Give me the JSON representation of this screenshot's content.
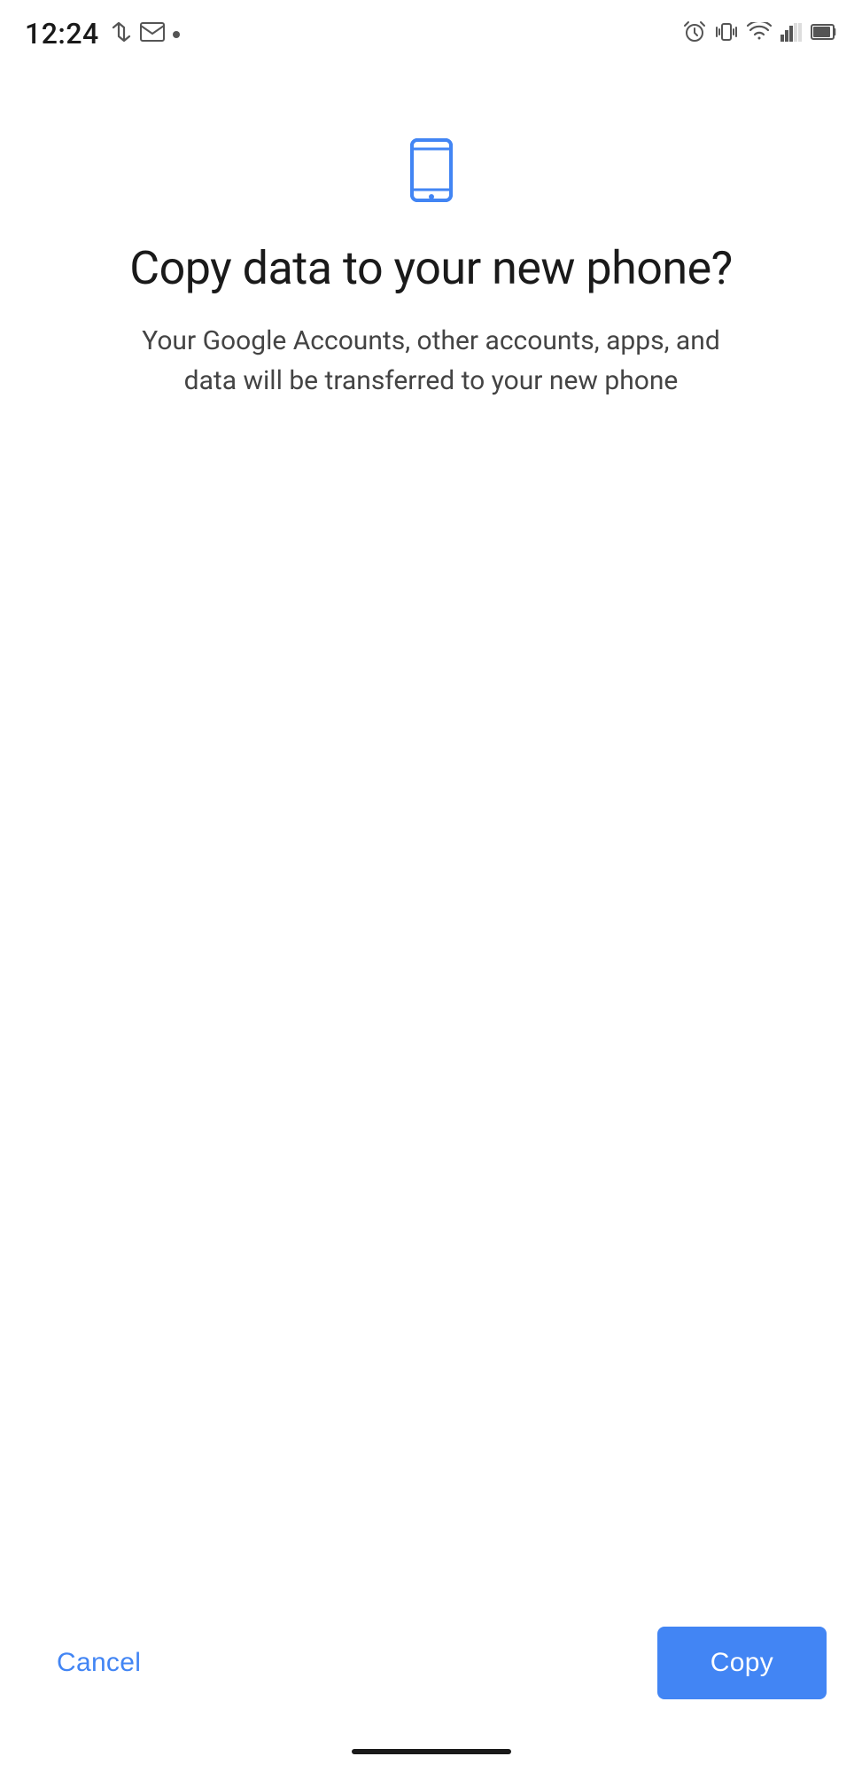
{
  "statusBar": {
    "time": "12:24",
    "leftIcons": [
      "arrow-transfer-icon",
      "gmail-icon",
      "dot-icon"
    ],
    "rightIcons": [
      "alarm-icon",
      "vibrate-icon",
      "wifi-icon",
      "signal-icon",
      "battery-icon"
    ]
  },
  "page": {
    "phoneIcon": "phone-icon",
    "title": "Copy data to your new phone?",
    "subtitle": "Your Google Accounts, other accounts, apps, and data will be transferred to your new phone"
  },
  "actions": {
    "cancelLabel": "Cancel",
    "copyLabel": "Copy"
  },
  "colors": {
    "accent": "#4285f4",
    "text_primary": "#1a1a1a",
    "text_secondary": "#444444",
    "white": "#ffffff"
  }
}
